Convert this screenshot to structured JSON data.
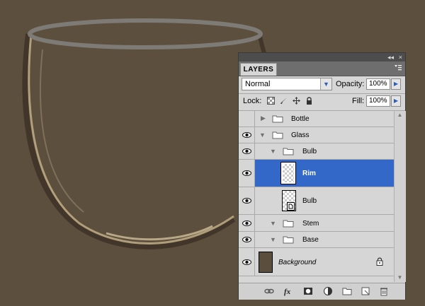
{
  "panel": {
    "tab_label": "LAYERS",
    "titlebar_collapse": "◂◂",
    "titlebar_close": "×",
    "menu_icon": "panel-menu-icon"
  },
  "blend_mode": {
    "value": "Normal"
  },
  "opacity": {
    "label": "Opacity:",
    "value": "100%"
  },
  "fill": {
    "label": "Fill:",
    "value": "100%"
  },
  "lock": {
    "label": "Lock:"
  },
  "layers": [
    {
      "name": "Bottle",
      "type": "group",
      "visible": false,
      "expanded": false
    },
    {
      "name": "Glass",
      "type": "group",
      "visible": true,
      "expanded": true
    },
    {
      "name": "Bulb",
      "type": "group",
      "visible": true,
      "expanded": true
    },
    {
      "name": "Rim",
      "type": "layer",
      "visible": true,
      "selected": true
    },
    {
      "name": "Bulb",
      "type": "layer",
      "visible": true,
      "selected": false
    },
    {
      "name": "Stem",
      "type": "group",
      "visible": true,
      "expanded": true
    },
    {
      "name": "Base",
      "type": "group",
      "visible": true,
      "expanded": true
    },
    {
      "name": "Background",
      "type": "background",
      "visible": true,
      "locked": true
    }
  ],
  "bottom_icons": [
    "link-icon",
    "fx-icon",
    "mask-icon",
    "adjustment-icon",
    "new-group-icon",
    "new-layer-icon",
    "trash-icon"
  ],
  "colors": {
    "canvas": "#5c4f3e",
    "selection": "#3368c8",
    "background_swatch": "#5b4e3c"
  }
}
